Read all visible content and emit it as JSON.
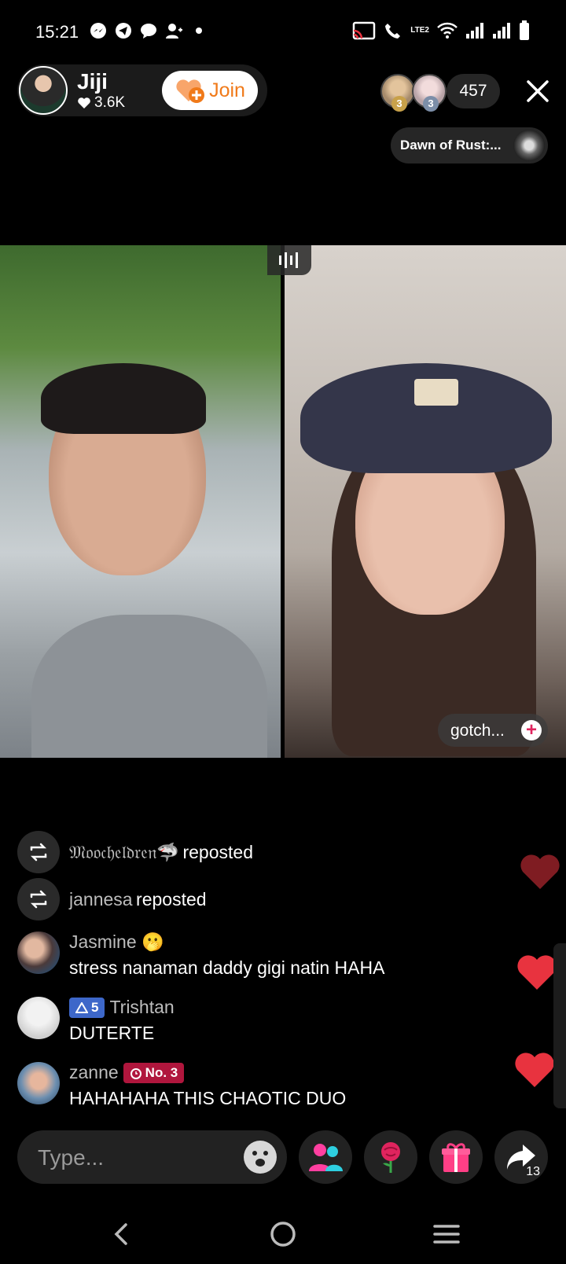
{
  "status_bar": {
    "time": "15:21",
    "network_label": "LTE2"
  },
  "host": {
    "name": "Jiji",
    "likes": "3.6K",
    "join_label": "Join"
  },
  "viewers": {
    "top_ranks": [
      "3",
      "3"
    ],
    "count": "457"
  },
  "game": {
    "label": "Dawn of Rust:..."
  },
  "guest": {
    "name": "gotch..."
  },
  "comments": [
    {
      "type": "repost",
      "user": "𝔐𝔬𝔬𝔠𝔥𝔢𝔩𝔡𝔯𝔢𝔫🦈",
      "action": "reposted"
    },
    {
      "type": "repost",
      "user": "jannesa",
      "action": "reposted"
    },
    {
      "type": "chat",
      "user": "Jasmine 🫢",
      "text": "stress nanaman daddy gigi natin HAHA"
    },
    {
      "type": "chat",
      "user": "Trishtan",
      "badge": "5",
      "text": "DUTERTE"
    },
    {
      "type": "chat",
      "user": "zanne",
      "badge": "No. 3",
      "text": "HAHAHAHA THIS CHAOTIC DUO"
    }
  ],
  "input": {
    "placeholder": "Type..."
  },
  "share": {
    "count": "13"
  },
  "colors": {
    "accent_join": "#f07a1a",
    "heart": "#e8333f",
    "level_badge": "#3d67c9",
    "rank_badge": "#b0163d"
  }
}
